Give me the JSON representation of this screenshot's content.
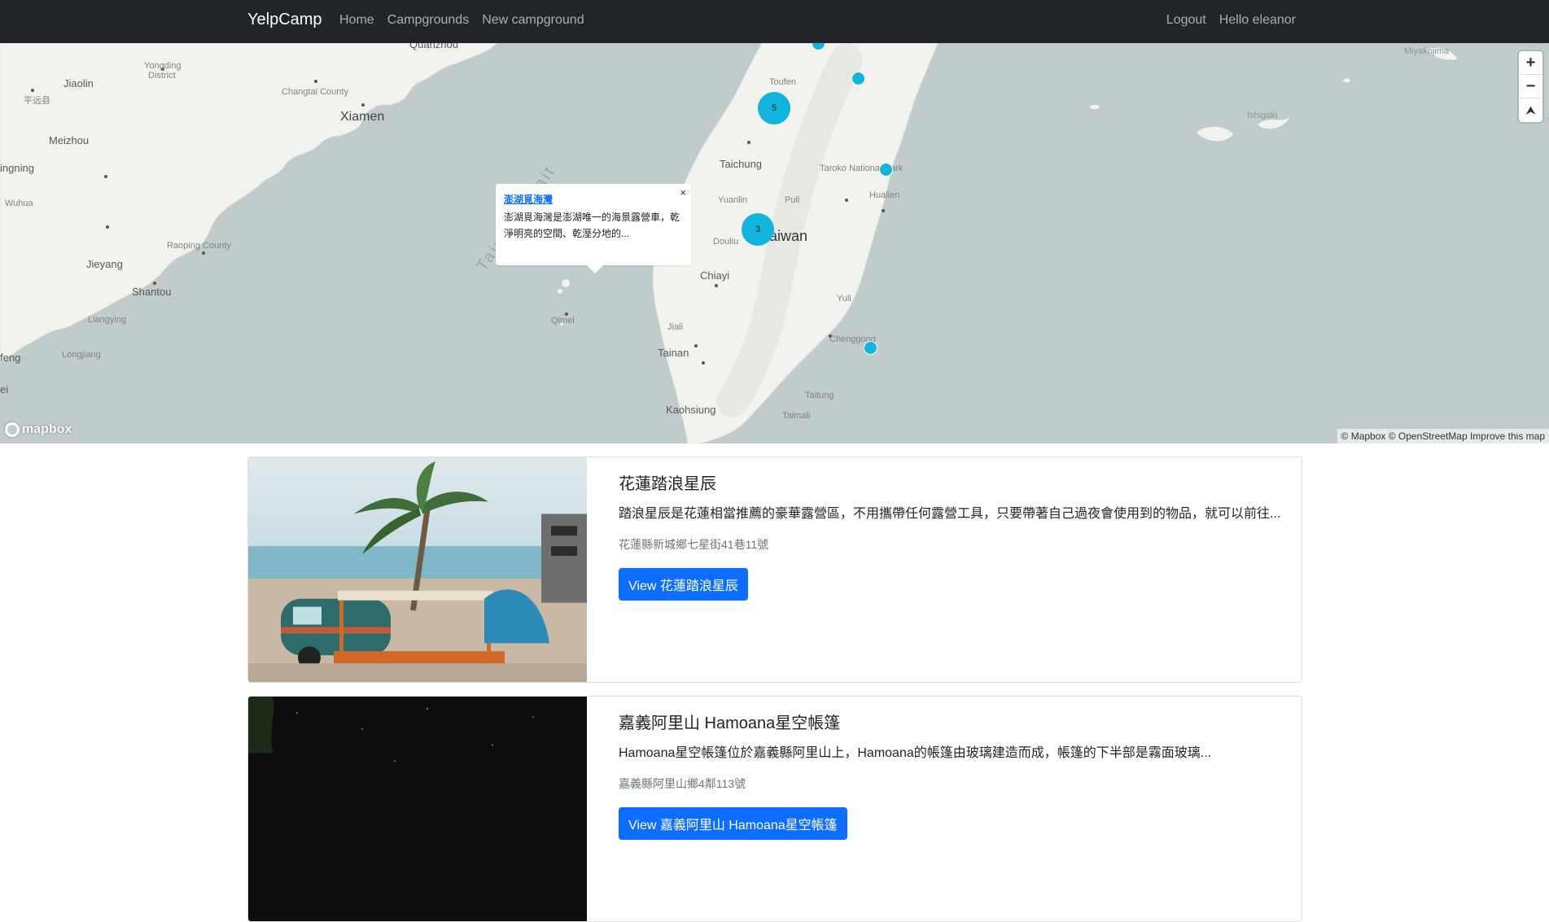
{
  "navbar": {
    "brand": "YelpCamp",
    "links": [
      "Home",
      "Campgrounds",
      "New campground"
    ],
    "right_links": [
      "Logout",
      "Hello eleanor"
    ]
  },
  "map": {
    "labels": {
      "quanzhou": "Quanzhou",
      "yongding": "Yongding",
      "district": "District",
      "jiaolin": "Jiaolin",
      "pingyuan": "平远县",
      "changtai": "Changtai County",
      "xiamen": "Xiamen",
      "meizhou": "Meizhou",
      "ningning": "ingning",
      "wuhua": "Wuhua",
      "raoping": "Raoping County",
      "jieyang": "Jieyang",
      "shantou": "Shantou",
      "liangying": "Liangying",
      "longjiang": "Longjiang",
      "feng": "feng",
      "ei": "ei",
      "strait": "Taiwan Strait",
      "qimei": "Qimei",
      "toufen": "Toufen",
      "taichung": "Taichung",
      "yuanlin": "Yuanlin",
      "puli": "Puli",
      "taroko": "Taroko National Park",
      "hualien": "Hualien",
      "taiwan": "Taiwan",
      "douliu": "Douliu",
      "chiayi": "Chiayi",
      "jiali": "Jiali",
      "tainan": "Tainan",
      "yuli": "Yuli",
      "chenggong": "Chenggong",
      "taitung": "Taitung",
      "taimali": "Taimali",
      "kaohsiung": "Kaohsiung",
      "miyakojima": "Miyakojima",
      "ishigaki": "Ishigaki"
    },
    "clusters": [
      "5",
      "3"
    ],
    "popup": {
      "close": "×",
      "title": "澎湖覓海灣",
      "description": "澎湖覓海灣是澎湖唯一的海景露營車，乾淨明亮的空間、乾溼分地的..."
    },
    "zoom_in": "+",
    "zoom_out": "−",
    "compass": "⮝",
    "logo": "mapbox",
    "attribution": "© Mapbox © OpenStreetMap Improve this map"
  },
  "campgrounds": [
    {
      "title": "花蓮踏浪星辰",
      "description": "踏浪星辰是花蓮相當推薦的豪華露營區，不用攜帶任何露營工具，只要帶著自己過夜會使用到的物品，就可以前往...",
      "location": "花蓮縣新城鄉七星街41巷11號",
      "button": "View 花蓮踏浪星辰"
    },
    {
      "title": "嘉義阿里山 Hamoana星空帳篷",
      "description": "Hamoana星空帳篷位於嘉義縣阿里山上，Hamoana的帳篷由玻璃建造而成，帳篷的下半部是霧面玻璃...",
      "location": "嘉義縣阿里山鄉4鄰113號",
      "button": "View 嘉義阿里山 Hamoana星空帳篷"
    }
  ],
  "colors": {
    "navbar": "#212529",
    "marker": "#11b4da",
    "primary_button": "#0d6efd",
    "water": "#bfcccb",
    "land": "#f2f2ef"
  }
}
